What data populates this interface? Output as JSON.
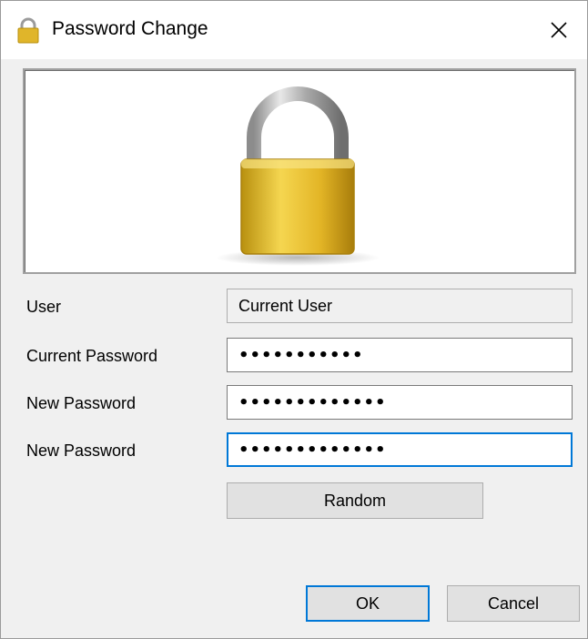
{
  "window": {
    "title": "Password Change",
    "icon": "padlock-icon",
    "close_icon": "close-icon"
  },
  "banner": {
    "image": "padlock-icon"
  },
  "form": {
    "user": {
      "label": "User",
      "value": "Current User"
    },
    "current_password": {
      "label": "Current Password",
      "value": "•••••••••••"
    },
    "new_password": {
      "label": "New Password",
      "value": "•••••••••••••"
    },
    "confirm_password": {
      "label": "New Password",
      "value": "•••••••••••••"
    }
  },
  "buttons": {
    "random": "Random",
    "ok": "OK",
    "cancel": "Cancel"
  },
  "colors": {
    "accent": "#0078d7",
    "padlock_gold": "#e0b52a",
    "dialog_bg": "#f0f0f0"
  }
}
